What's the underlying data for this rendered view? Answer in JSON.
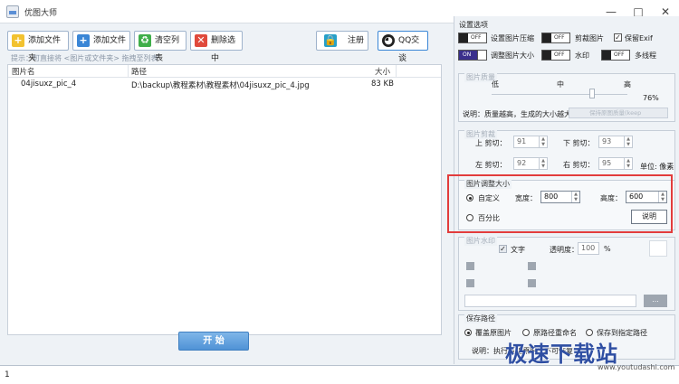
{
  "window": {
    "title": "优图大师",
    "minimize": "—",
    "maximize": "□",
    "close": "✕"
  },
  "toolbar": {
    "add_folder": "添加文件夹",
    "add_file": "添加文件",
    "clear_list": "清空列表",
    "delete_selected": "删除选中",
    "register": "注册",
    "qq_chat": "QQ交谈",
    "icons": {
      "add_folder": "folder-plus-icon",
      "add_file": "file-plus-icon",
      "clear_list": "recycle-icon",
      "delete_selected": "delete-icon",
      "register": "lock-icon",
      "qq_chat": "qq-penguin-icon"
    }
  },
  "hint": "提示：可直接将 <图片或文件夹> 拖拽至列表",
  "file_list": {
    "columns": [
      "图片名",
      "路径",
      "大小"
    ],
    "rows": [
      {
        "name": "04jisuxz_pic_4",
        "path": "D:\\backup\\教程素材\\教程素材\\04jisuxz_pic_4.jpg",
        "size": "83 KB"
      }
    ]
  },
  "start_button": "开 始",
  "settings": {
    "title": "设置选项",
    "options": {
      "compress": {
        "label": "设置图片压缩",
        "state": "OFF"
      },
      "crop": {
        "label": "剪裁图片",
        "state": "OFF"
      },
      "keep_exif": {
        "label": "保留Exif",
        "checked": true
      },
      "resize": {
        "label": "调整图片大小",
        "state": "ON"
      },
      "watermark": {
        "label": "水印",
        "state": "OFF"
      },
      "multithread": {
        "label": "多线程",
        "state": "OFF"
      }
    }
  },
  "quality": {
    "title": "图片质量",
    "low": "低",
    "mid": "中",
    "high": "高",
    "value": "76%",
    "note": "说明：质量越高，生成的大小越大",
    "keep_label": "保持原图质量(keep original)"
  },
  "crop": {
    "title": "图片剪裁",
    "top_crop_label": "上 剪切：",
    "top_crop_value": "91",
    "bottom_crop_label": "下 剪切：",
    "bottom_crop_value": "93",
    "left_crop_label": "左 剪切：",
    "left_crop_value": "92",
    "right_crop_label": "右 剪切：",
    "right_crop_value": "95",
    "unit": "单位: 像素"
  },
  "resize": {
    "title": "图片调整大小",
    "custom_label": "自定义",
    "width_label": "宽度：",
    "width_value": "800",
    "height_label": "高度：",
    "height_value": "600",
    "percent_label": "百分比",
    "explain_button": "说明"
  },
  "watermark_group": {
    "title": "图片水印",
    "text_label": "文字",
    "opacity_label": "透明度：",
    "opacity_value": "100",
    "opacity_unit": "%",
    "browse": "..."
  },
  "save_path": {
    "title": "保存路径",
    "overwrite": "覆盖原图片",
    "rename": "原路径重命名",
    "specified": "保存到指定路径",
    "note": "说明：执行覆盖原图片不可恢复"
  },
  "status": {
    "count": "1"
  },
  "watermark_brand": {
    "text": "极速下载站",
    "url": "www.youtudashi.com"
  }
}
